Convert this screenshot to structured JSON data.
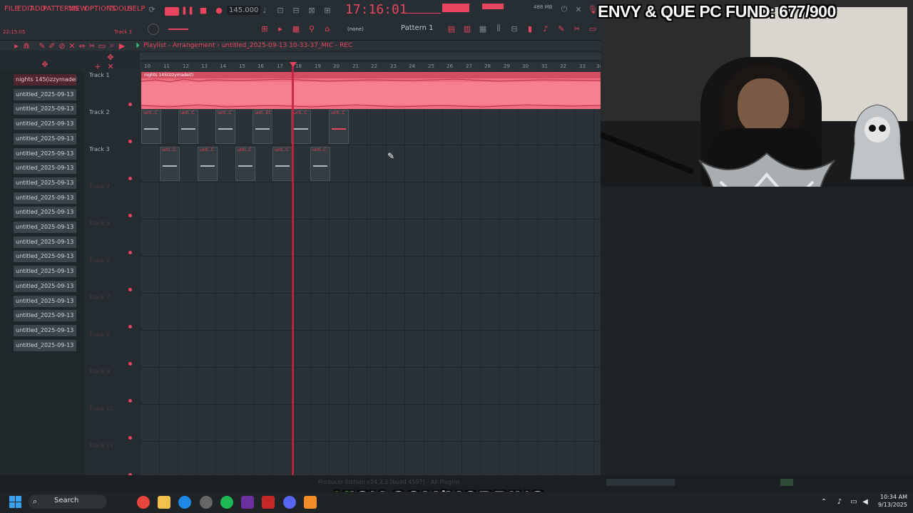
{
  "menu": [
    "FILE",
    "EDIT",
    "ADD",
    "PATTERNS",
    "VIEW",
    "OPTIONS",
    "TOOLS",
    "HELP"
  ],
  "toolbar": {
    "tempo": "145.000",
    "song_time": "17:16:01",
    "elapsed": "22:15:05",
    "track_hint": "Track 3",
    "pattern": "Pattern 1",
    "none": "(none)",
    "mem": "488 MB"
  },
  "playlist": {
    "title": "Playlist - Arrangement  ›  untitled_2025-09-13 10-33-37_MIC - REC",
    "ruler": [
      "10",
      "11",
      "12",
      "13",
      "14",
      "15",
      "16",
      "17",
      "18",
      "19",
      "20",
      "21",
      "22",
      "23",
      "24",
      "25",
      "26",
      "27",
      "28",
      "29",
      "30",
      "31",
      "32",
      "33",
      "34"
    ],
    "tracks": [
      "Track 1",
      "Track 2",
      "Track 3",
      "Track 4",
      "Track 5",
      "Track 6",
      "Track 7",
      "Track 8",
      "Track 9",
      "Track 10",
      "Track 11"
    ],
    "audio_clip": "nights 145(izzymadeit)",
    "track2_clips": [
      "unti..C",
      "unti..C",
      "unti..C",
      "unti..EC",
      "unti..C",
      "unti..C"
    ],
    "track3_clips": [
      "unti..C",
      "unti..C",
      "unti..C",
      "unti..C",
      "unti..C"
    ]
  },
  "browser": {
    "items": [
      "nights 145(izzymadei..",
      "untitled_2025-09-13 10-",
      "untitled_2025-09-13 10-",
      "untitled_2025-09-13 10-",
      "untitled_2025-09-13 10-",
      "untitled_2025-09-13 10-",
      "untitled_2025-09-13 10-",
      "untitled_2025-09-13 10-",
      "untitled_2025-09-13 10-",
      "untitled_2025-09-13 10-",
      "untitled_2025-09-13 10-",
      "untitled_2025-09-13 10-",
      "untitled_2025-09-13 10-",
      "untitled_2025-09-13 10-",
      "untitled_2025-09-13 10-",
      "untitled_2025-09-13 10-",
      "untitled_2025-09-13 10-",
      "untitled_2025-09-13 10-",
      "untitled_2025-09-13 10-"
    ]
  },
  "overlay": {
    "fund": "ENVY & QUE PC FUND: 677/900",
    "kick_prefix": "K",
    "kick_rest": "ICK.COM/MOBBING"
  },
  "statusbar": "Producer Edition v24.2.2 [build 4597] - All Plugins",
  "taskbar": {
    "search": "Search",
    "time": "10:34 AM",
    "date": "9/13/2025"
  },
  "colors": {
    "accent": "#e8455c",
    "clip": "#f06e80",
    "kick_green": "#53fc18"
  }
}
